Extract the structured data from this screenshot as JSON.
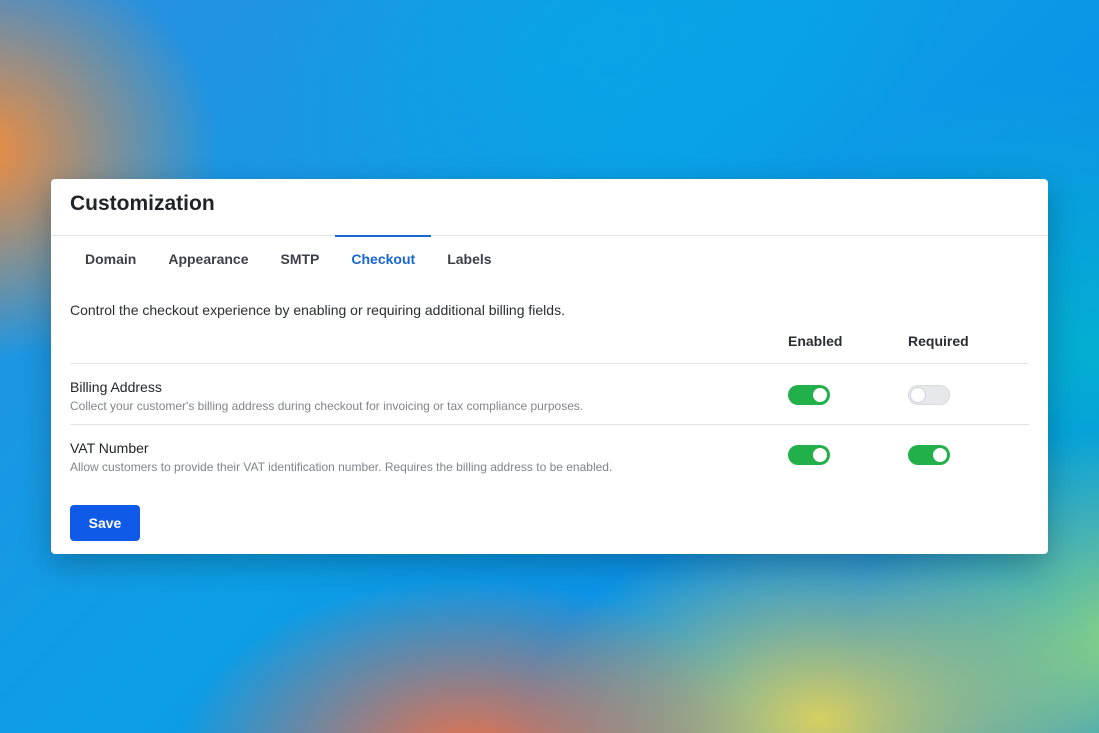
{
  "card": {
    "title": "Customization"
  },
  "tabs": [
    {
      "label": "Domain",
      "active": false
    },
    {
      "label": "Appearance",
      "active": false
    },
    {
      "label": "SMTP",
      "active": false
    },
    {
      "label": "Checkout",
      "active": true
    },
    {
      "label": "Labels",
      "active": false
    }
  ],
  "checkout": {
    "description": "Control the checkout experience by enabling or requiring additional billing fields.",
    "columns": {
      "enabled": "Enabled",
      "required": "Required"
    },
    "rows": [
      {
        "title": "Billing Address",
        "subtitle": "Collect your customer's billing address during checkout for invoicing or tax compliance purposes.",
        "enabled": true,
        "required": false
      },
      {
        "title": "VAT Number",
        "subtitle": "Allow customers to provide their VAT identification number. Requires the billing address to be enabled.",
        "enabled": true,
        "required": true
      }
    ],
    "save_label": "Save"
  },
  "colors": {
    "accent": "#1865d6",
    "toggle_on": "#22b04b",
    "save_button": "#0f5be8"
  }
}
